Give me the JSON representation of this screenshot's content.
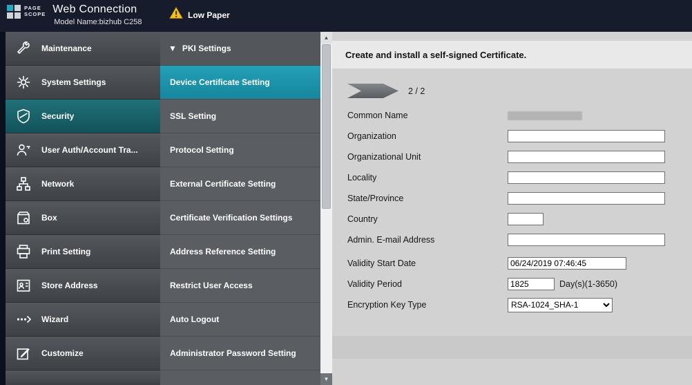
{
  "header": {
    "logo_line1": "PAGE",
    "logo_line2": "SCOPE",
    "title": "Web Connection",
    "model": "Model Name:bizhub C258",
    "alert": "Low Paper",
    "alert_icon": "warning-triangle-icon",
    "topbar_color": "#171c2d"
  },
  "sidebar": {
    "items": [
      {
        "label": "Maintenance",
        "icon": "wrench-icon"
      },
      {
        "label": "System Settings",
        "icon": "gear-icon"
      },
      {
        "label": "Security",
        "icon": "shield-icon",
        "active": true
      },
      {
        "label": "User Auth/Account Tra...",
        "icon": "user-key-icon"
      },
      {
        "label": "Network",
        "icon": "network-icon"
      },
      {
        "label": "Box",
        "icon": "box-icon"
      },
      {
        "label": "Print Setting",
        "icon": "printer-icon"
      },
      {
        "label": "Store Address",
        "icon": "address-book-icon"
      },
      {
        "label": "Wizard",
        "icon": "wizard-icon"
      },
      {
        "label": "Customize",
        "icon": "pencil-icon"
      }
    ],
    "active_color": "#17606a"
  },
  "submenu": {
    "header_arrow": "▼",
    "header": "PKI Settings",
    "items": [
      {
        "label": "Device Certificate Setting",
        "active": true
      },
      {
        "label": "SSL Setting"
      },
      {
        "label": "Protocol Setting"
      },
      {
        "label": "External Certificate Setting"
      },
      {
        "label": "Certificate Verification Settings"
      },
      {
        "label": "Address Reference Setting"
      },
      {
        "label": "Restrict User Access"
      },
      {
        "label": "Auto Logout"
      },
      {
        "label": "Administrator Password Setting"
      }
    ],
    "active_color": "#1d97ad"
  },
  "scrollbar": {
    "up_glyph": "▲",
    "down_glyph": "▼"
  },
  "main": {
    "heading": "Create and install a self-signed Certificate.",
    "step": "2 / 2",
    "form": {
      "common_name": {
        "label": "Common Name",
        "value_redacted": true
      },
      "organization": {
        "label": "Organization",
        "value": ""
      },
      "organizational_unit": {
        "label": "Organizational Unit",
        "value": ""
      },
      "locality": {
        "label": "Locality",
        "value": ""
      },
      "state_province": {
        "label": "State/Province",
        "value": ""
      },
      "country": {
        "label": "Country",
        "value": ""
      },
      "admin_email": {
        "label": "Admin. E-mail Address",
        "value": ""
      },
      "validity_start_date": {
        "label": "Validity Start Date",
        "value": "06/24/2019 07:46:45"
      },
      "validity_period": {
        "label": "Validity Period",
        "value": "1825",
        "suffix": "Day(s)(1-3650)"
      },
      "encryption_key_type": {
        "label": "Encryption Key Type",
        "value": "RSA-1024_SHA-1"
      }
    }
  }
}
